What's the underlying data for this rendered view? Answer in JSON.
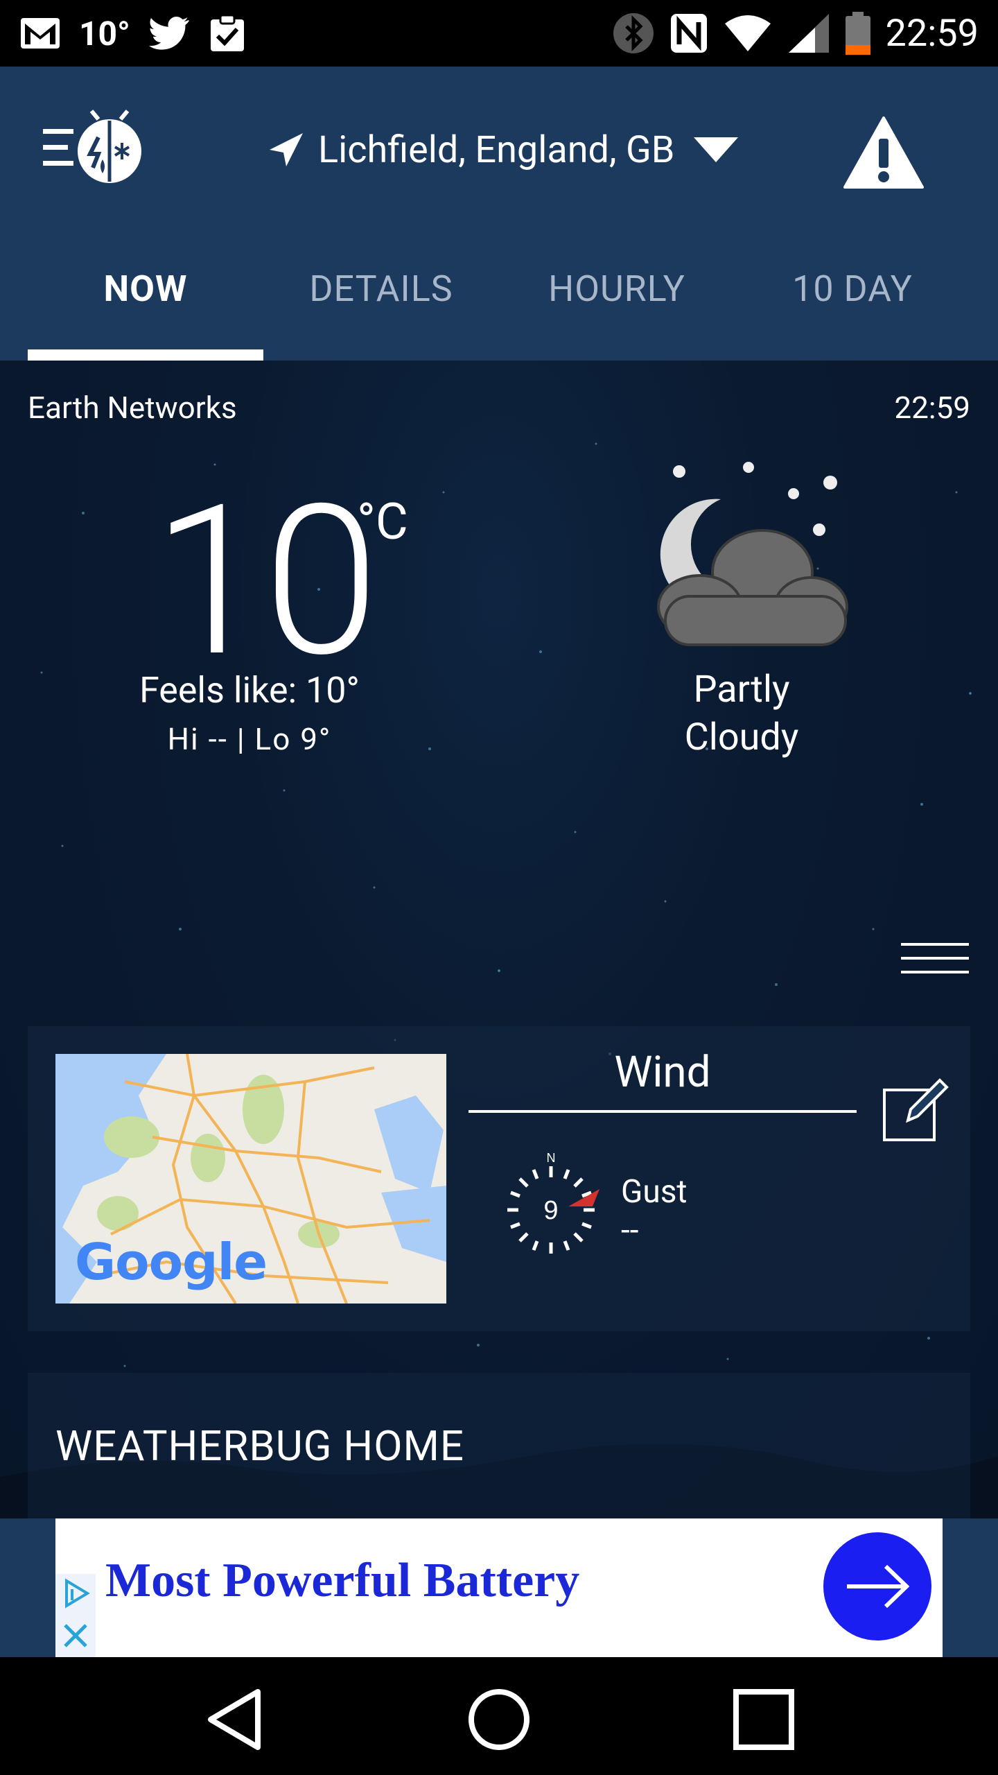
{
  "status_bar": {
    "temperature": "10°",
    "time": "22:59",
    "icons": [
      "gmail-icon",
      "twitter-icon",
      "clipboard-check-icon",
      "bluetooth-icon",
      "nfc-icon",
      "wifi-icon",
      "signal-icon",
      "battery-low-icon"
    ],
    "battery_accent": "#ff6a00"
  },
  "header": {
    "location": "Lichfield, England, GB",
    "background": "#1b3a5e",
    "tabs": [
      {
        "label": "NOW",
        "active": true
      },
      {
        "label": "DETAILS",
        "active": false
      },
      {
        "label": "HOURLY",
        "active": false
      },
      {
        "label": "10 DAY",
        "active": false
      }
    ]
  },
  "now": {
    "provider": "Earth Networks",
    "updated_time": "22:59",
    "temperature": "10",
    "unit": "°C",
    "feels_like": "Feels like: 10°",
    "hi_lo": "Hi -- | Lo 9°",
    "condition_icon": "partly-cloudy-night-icon",
    "condition_line1": "Partly",
    "condition_line2": "Cloudy"
  },
  "wind_card": {
    "map_brand": "Google",
    "title": "Wind",
    "compass_north": "N",
    "speed": "9",
    "gust_label": "Gust",
    "gust_value": "--",
    "arrow_color": "#d3332e"
  },
  "home_card": {
    "title": "WEATHERBUG HOME"
  },
  "ad": {
    "text": "Most Powerful Battery",
    "text_color": "#1a28d8",
    "button_color": "#1a1ef0"
  }
}
